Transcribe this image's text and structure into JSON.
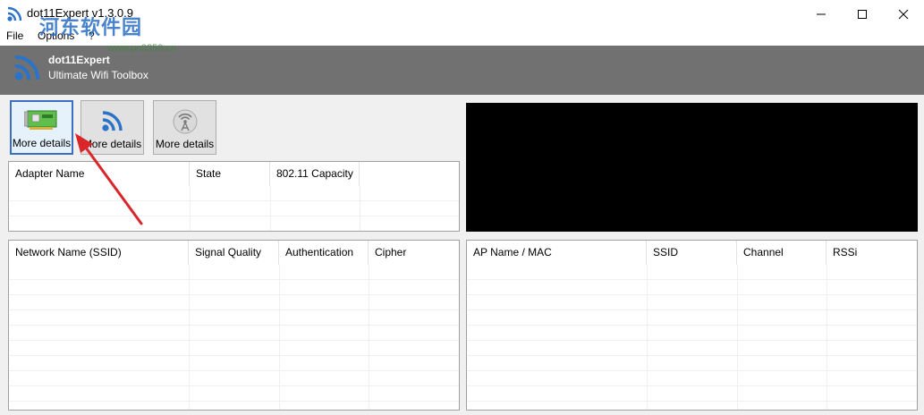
{
  "window": {
    "title": "dot11Expert v1.3.0.9"
  },
  "watermark": {
    "big": "河东软件园",
    "small": "www.pc0359.cn"
  },
  "menu": {
    "file": "File",
    "options": "Options",
    "help": "?"
  },
  "banner": {
    "title": "dot11Expert",
    "subtitle": "Ultimate Wifi Toolbox"
  },
  "tools": [
    {
      "label": "More details",
      "icon": "network-card-icon"
    },
    {
      "label": "More details",
      "icon": "wifi-icon"
    },
    {
      "label": "More details",
      "icon": "access-point-icon"
    }
  ],
  "adapter_table": {
    "columns": [
      "Adapter Name",
      "State",
      "802.11 Capacity",
      ""
    ],
    "rows": []
  },
  "network_table": {
    "columns": [
      "Network Name (SSID)",
      "Signal Quality",
      "Authentication",
      "Cipher"
    ],
    "rows": []
  },
  "ap_table": {
    "columns": [
      "AP Name / MAC",
      "SSID",
      "Channel",
      "RSSi"
    ],
    "rows": []
  },
  "colors": {
    "banner": "#717171",
    "wifi_blue": "#2a73c8",
    "annotation_arrow": "#d9262b",
    "selected_border": "#3b6fbf"
  }
}
